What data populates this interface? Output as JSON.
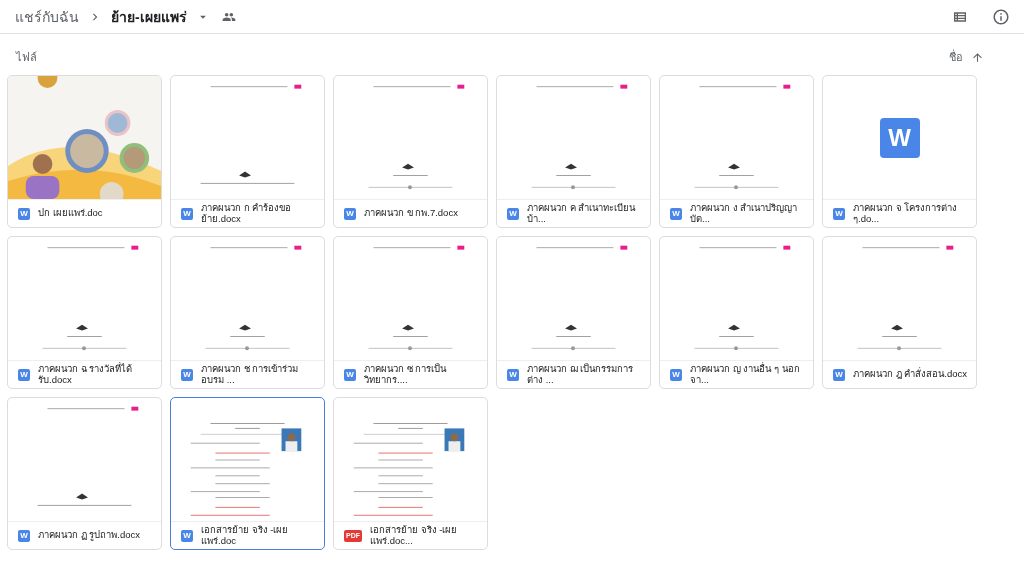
{
  "breadcrumb": [
    {
      "label": "แชร์กับฉัน",
      "current": false
    },
    {
      "label": "ย้าย-เผยแพร่",
      "current": true
    }
  ],
  "section_label": "ไฟล์",
  "sort": {
    "label": "ชื่อ"
  },
  "files": [
    {
      "name": "ปก เผยแพร่.doc",
      "kind": "word",
      "badge": "W",
      "selected": false
    },
    {
      "name": "ภาคผนวก ก คำร้องขอย้าย.docx",
      "kind": "word",
      "badge": "W",
      "thumbnail": {
        "kind": "emblem"
      },
      "selected": false
    },
    {
      "name": "ภาคผนวก ข กพ.7.docx",
      "kind": "word",
      "badge": "W",
      "thumbnail": {
        "kind": "title"
      },
      "selected": false
    },
    {
      "name": "ภาคผนวก ค สำเนาทะเบียนบ้า...",
      "kind": "word",
      "badge": "W",
      "thumbnail": {
        "kind": "title"
      },
      "selected": false
    },
    {
      "name": "ภาคผนวก ง สำเนาปริญญาบัต...",
      "kind": "word",
      "badge": "W",
      "thumbnail": {
        "kind": "title"
      },
      "selected": false
    },
    {
      "name": "ภาคผนวก จ โครงการต่าง ๆ.do...",
      "kind": "word",
      "badge": "W",
      "thumbnail": {
        "kind": "word",
        "text": "W"
      },
      "selected": false
    },
    {
      "name": "ภาคผนวก ฉ รางวัลที่ได้รับ.docx",
      "kind": "word",
      "badge": "W",
      "thumbnail": {
        "kind": "title"
      },
      "selected": false
    },
    {
      "name": "ภาคผนวก ช การเข้าร่วมอบรม ...",
      "kind": "word",
      "badge": "W",
      "thumbnail": {
        "kind": "title"
      },
      "selected": false
    },
    {
      "name": "ภาคผนวก ซ การเป็นวิทยากร....",
      "kind": "word",
      "badge": "W",
      "thumbnail": {
        "kind": "title"
      },
      "selected": false
    },
    {
      "name": "ภาคผนวก ฌ เป็นกรรมการต่าง ...",
      "kind": "word",
      "badge": "W",
      "thumbnail": {
        "kind": "title"
      },
      "selected": false
    },
    {
      "name": "ภาคผนวก ญ งานอื่น ๆ นอกจา...",
      "kind": "word",
      "badge": "W",
      "thumbnail": {
        "kind": "title"
      },
      "selected": false
    },
    {
      "name": "ภาคผนวก ฎ คำสั่งสอน.docx",
      "kind": "word",
      "badge": "W",
      "thumbnail": {
        "kind": "title"
      },
      "selected": false
    },
    {
      "name": "ภาคผนวก ฏ รูปถาพ.docx",
      "kind": "word",
      "badge": "W",
      "thumbnail": {
        "kind": "emblem"
      },
      "selected": false
    },
    {
      "name": "เอกสารย้าย จริง -เผยแพร่.doc",
      "kind": "word",
      "badge": "W",
      "thumbnail": {
        "kind": "form"
      },
      "selected": true
    },
    {
      "name": "เอกสารย้าย จริง -เผยแพร่.doc...",
      "kind": "pdf",
      "badge": "PDF",
      "thumbnail": {
        "kind": "form"
      },
      "selected": false
    }
  ]
}
